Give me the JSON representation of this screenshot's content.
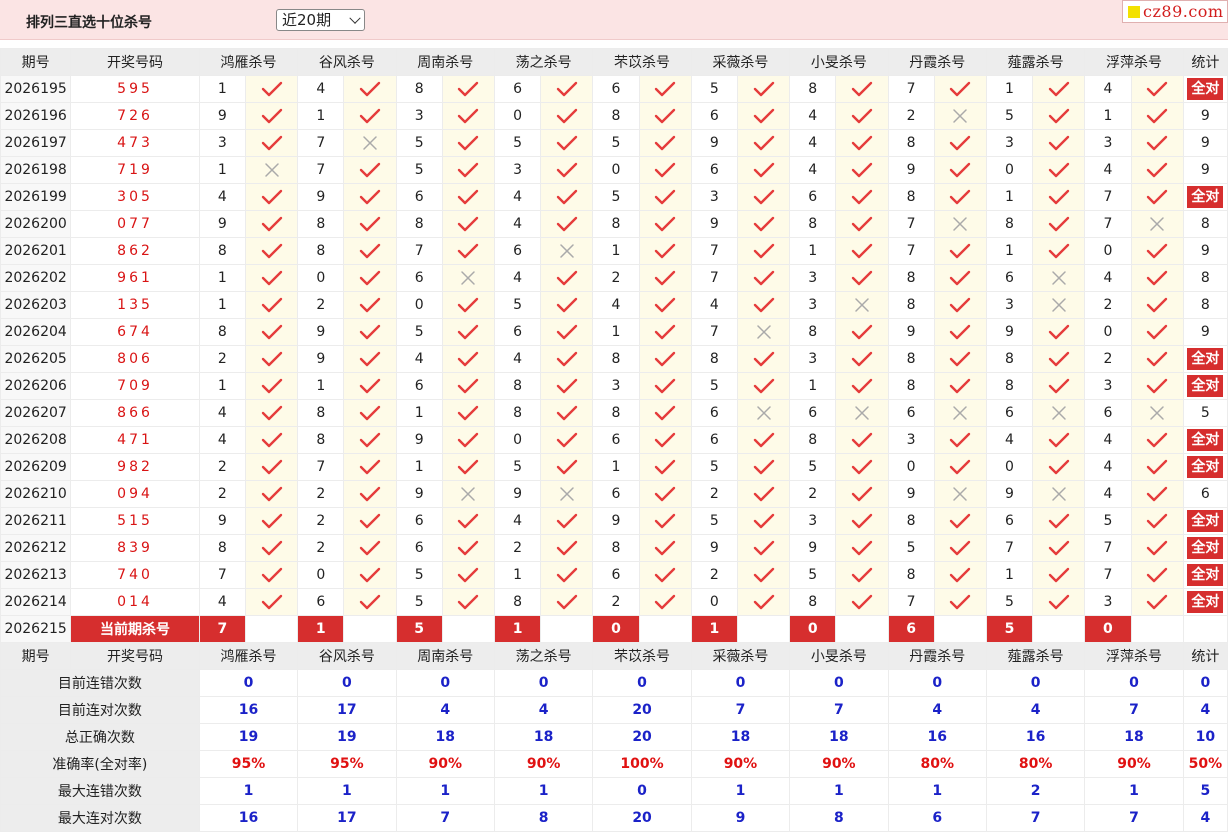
{
  "header": {
    "title": "排列三直选十位杀号",
    "period_select": "近20期",
    "logo_text": "cz89.com"
  },
  "columns": {
    "issue": "期号",
    "draw": "开奖号码",
    "experts": [
      "鸿雁杀号",
      "谷风杀号",
      "周南杀号",
      "荡之杀号",
      "芣苡杀号",
      "采薇杀号",
      "小旻杀号",
      "丹霞杀号",
      "薤露杀号",
      "浮萍杀号"
    ],
    "stat": "统计"
  },
  "rows": [
    {
      "issue": "2026195",
      "draw": "595",
      "kills": [
        1,
        4,
        8,
        6,
        6,
        5,
        8,
        7,
        1,
        4
      ],
      "hits": [
        1,
        1,
        1,
        1,
        1,
        1,
        1,
        1,
        1,
        1
      ],
      "stat": "全对"
    },
    {
      "issue": "2026196",
      "draw": "726",
      "kills": [
        9,
        1,
        3,
        0,
        8,
        6,
        4,
        2,
        5,
        1
      ],
      "hits": [
        1,
        1,
        1,
        1,
        1,
        1,
        1,
        0,
        1,
        1
      ],
      "stat": "9"
    },
    {
      "issue": "2026197",
      "draw": "473",
      "kills": [
        3,
        7,
        5,
        5,
        5,
        9,
        4,
        8,
        3,
        3
      ],
      "hits": [
        1,
        0,
        1,
        1,
        1,
        1,
        1,
        1,
        1,
        1
      ],
      "stat": "9"
    },
    {
      "issue": "2026198",
      "draw": "719",
      "kills": [
        1,
        7,
        5,
        3,
        0,
        6,
        4,
        9,
        0,
        4
      ],
      "hits": [
        0,
        1,
        1,
        1,
        1,
        1,
        1,
        1,
        1,
        1
      ],
      "stat": "9"
    },
    {
      "issue": "2026199",
      "draw": "305",
      "kills": [
        4,
        9,
        6,
        4,
        5,
        3,
        6,
        8,
        1,
        7
      ],
      "hits": [
        1,
        1,
        1,
        1,
        1,
        1,
        1,
        1,
        1,
        1
      ],
      "stat": "全对"
    },
    {
      "issue": "2026200",
      "draw": "077",
      "kills": [
        9,
        8,
        8,
        4,
        8,
        9,
        8,
        7,
        8,
        7
      ],
      "hits": [
        1,
        1,
        1,
        1,
        1,
        1,
        1,
        0,
        1,
        0
      ],
      "stat": "8"
    },
    {
      "issue": "2026201",
      "draw": "862",
      "kills": [
        8,
        8,
        7,
        6,
        1,
        7,
        1,
        7,
        1,
        0
      ],
      "hits": [
        1,
        1,
        1,
        0,
        1,
        1,
        1,
        1,
        1,
        1
      ],
      "stat": "9"
    },
    {
      "issue": "2026202",
      "draw": "961",
      "kills": [
        1,
        0,
        6,
        4,
        2,
        7,
        3,
        8,
        6,
        4
      ],
      "hits": [
        1,
        1,
        0,
        1,
        1,
        1,
        1,
        1,
        0,
        1
      ],
      "stat": "8"
    },
    {
      "issue": "2026203",
      "draw": "135",
      "kills": [
        1,
        2,
        0,
        5,
        4,
        4,
        3,
        8,
        3,
        2
      ],
      "hits": [
        1,
        1,
        1,
        1,
        1,
        1,
        0,
        1,
        0,
        1
      ],
      "stat": "8"
    },
    {
      "issue": "2026204",
      "draw": "674",
      "kills": [
        8,
        9,
        5,
        6,
        1,
        7,
        8,
        9,
        9,
        0
      ],
      "hits": [
        1,
        1,
        1,
        1,
        1,
        0,
        1,
        1,
        1,
        1
      ],
      "stat": "9"
    },
    {
      "issue": "2026205",
      "draw": "806",
      "kills": [
        2,
        9,
        4,
        4,
        8,
        8,
        3,
        8,
        8,
        2
      ],
      "hits": [
        1,
        1,
        1,
        1,
        1,
        1,
        1,
        1,
        1,
        1
      ],
      "stat": "全对"
    },
    {
      "issue": "2026206",
      "draw": "709",
      "kills": [
        1,
        1,
        6,
        8,
        3,
        5,
        1,
        8,
        8,
        3
      ],
      "hits": [
        1,
        1,
        1,
        1,
        1,
        1,
        1,
        1,
        1,
        1
      ],
      "stat": "全对"
    },
    {
      "issue": "2026207",
      "draw": "866",
      "kills": [
        4,
        8,
        1,
        8,
        8,
        6,
        6,
        6,
        6,
        6
      ],
      "hits": [
        1,
        1,
        1,
        1,
        1,
        0,
        0,
        0,
        0,
        0
      ],
      "stat": "5"
    },
    {
      "issue": "2026208",
      "draw": "471",
      "kills": [
        4,
        8,
        9,
        0,
        6,
        6,
        8,
        3,
        4,
        4
      ],
      "hits": [
        1,
        1,
        1,
        1,
        1,
        1,
        1,
        1,
        1,
        1
      ],
      "stat": "全对"
    },
    {
      "issue": "2026209",
      "draw": "982",
      "kills": [
        2,
        7,
        1,
        5,
        1,
        5,
        5,
        0,
        0,
        4
      ],
      "hits": [
        1,
        1,
        1,
        1,
        1,
        1,
        1,
        1,
        1,
        1
      ],
      "stat": "全对"
    },
    {
      "issue": "2026210",
      "draw": "094",
      "kills": [
        2,
        2,
        9,
        9,
        6,
        2,
        2,
        9,
        9,
        4
      ],
      "hits": [
        1,
        1,
        0,
        0,
        1,
        1,
        1,
        0,
        0,
        1
      ],
      "stat": "6"
    },
    {
      "issue": "2026211",
      "draw": "515",
      "kills": [
        9,
        2,
        6,
        4,
        9,
        5,
        3,
        8,
        6,
        5
      ],
      "hits": [
        1,
        1,
        1,
        1,
        1,
        1,
        1,
        1,
        1,
        1
      ],
      "stat": "全对"
    },
    {
      "issue": "2026212",
      "draw": "839",
      "kills": [
        8,
        2,
        6,
        2,
        8,
        9,
        9,
        5,
        7,
        7
      ],
      "hits": [
        1,
        1,
        1,
        1,
        1,
        1,
        1,
        1,
        1,
        1
      ],
      "stat": "全对"
    },
    {
      "issue": "2026213",
      "draw": "740",
      "kills": [
        7,
        0,
        5,
        1,
        6,
        2,
        5,
        8,
        1,
        7
      ],
      "hits": [
        1,
        1,
        1,
        1,
        1,
        1,
        1,
        1,
        1,
        1
      ],
      "stat": "全对"
    },
    {
      "issue": "2026214",
      "draw": "014",
      "kills": [
        4,
        6,
        5,
        8,
        2,
        0,
        8,
        7,
        5,
        3
      ],
      "hits": [
        1,
        1,
        1,
        1,
        1,
        1,
        1,
        1,
        1,
        1
      ],
      "stat": "全对"
    }
  ],
  "current": {
    "issue": "2026215",
    "label": "当前期杀号",
    "kills": [
      7,
      1,
      5,
      1,
      0,
      1,
      0,
      6,
      5,
      0
    ]
  },
  "stats": [
    {
      "label": "目前连错次数",
      "values": [
        "0",
        "0",
        "0",
        "0",
        "0",
        "0",
        "0",
        "0",
        "0",
        "0"
      ],
      "total": "0",
      "red": false
    },
    {
      "label": "目前连对次数",
      "values": [
        "16",
        "17",
        "4",
        "4",
        "20",
        "7",
        "7",
        "4",
        "4",
        "7"
      ],
      "total": "4",
      "red": false
    },
    {
      "label": "总正确次数",
      "values": [
        "19",
        "19",
        "18",
        "18",
        "20",
        "18",
        "18",
        "16",
        "16",
        "18"
      ],
      "total": "10",
      "red": false
    },
    {
      "label": "准确率(全对率)",
      "values": [
        "95%",
        "95%",
        "90%",
        "90%",
        "100%",
        "90%",
        "90%",
        "80%",
        "80%",
        "90%"
      ],
      "total": "50%",
      "red": true
    },
    {
      "label": "最大连错次数",
      "values": [
        "1",
        "1",
        "1",
        "1",
        "0",
        "1",
        "1",
        "1",
        "2",
        "1"
      ],
      "total": "5",
      "red": false
    },
    {
      "label": "最大连对次数",
      "values": [
        "16",
        "17",
        "7",
        "8",
        "20",
        "9",
        "8",
        "6",
        "7",
        "7"
      ],
      "total": "4",
      "red": false
    }
  ],
  "icons": {
    "hit": "check-icon",
    "miss": "cross-icon"
  },
  "colors": {
    "check": "#e53b3b",
    "cross": "#aaaaaa",
    "badge": "#d62e2e",
    "stat_blue": "#1b22c8",
    "stat_red": "#e01111",
    "draw_red": "#d91414"
  }
}
